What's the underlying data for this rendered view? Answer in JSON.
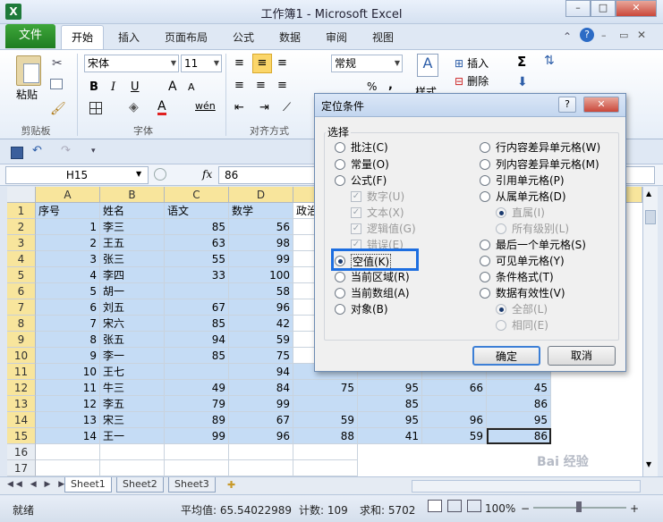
{
  "window": {
    "title": "工作簿1 - Microsoft Excel",
    "app_icon": "X",
    "min": "–",
    "max": "□",
    "close": "✕"
  },
  "ribbon_tabs": {
    "file": "文件",
    "home": "开始",
    "insert": "插入",
    "layout": "页面布局",
    "formula": "公式",
    "data": "数据",
    "review": "审阅",
    "view": "视图"
  },
  "ribbon": {
    "paste_label": "粘贴",
    "clipboard_group": "剪贴板",
    "font_name": "宋体",
    "font_size": "11",
    "font_group": "字体",
    "bold": "B",
    "italic": "I",
    "underline": "U",
    "grow_font": "A",
    "shrink_font": "A",
    "wen": "wén",
    "align_group": "对齐方式",
    "number_format": "常规",
    "percent": "%",
    "comma": ",",
    "styles_label": "样式",
    "insert_label": "插入",
    "delete_label": "删除",
    "sigma": "Σ"
  },
  "formula_bar": {
    "name_box": "H15",
    "fx": "fx",
    "value": "86"
  },
  "grid": {
    "columns": [
      "A",
      "B",
      "C",
      "D",
      "E"
    ],
    "rows": [
      {
        "n": "1",
        "A": "序号",
        "B": "姓名",
        "C": "语文",
        "D": "数学",
        "E": "政治"
      },
      {
        "n": "2",
        "A": "1",
        "B": "李三",
        "C": "85",
        "D": "56"
      },
      {
        "n": "3",
        "A": "2",
        "B": "王五",
        "C": "63",
        "D": "98"
      },
      {
        "n": "4",
        "A": "3",
        "B": "张三",
        "C": "55",
        "D": "99"
      },
      {
        "n": "5",
        "A": "4",
        "B": "李四",
        "C": "33",
        "D": "100"
      },
      {
        "n": "6",
        "A": "5",
        "B": "胡一",
        "C": "",
        "D": "58"
      },
      {
        "n": "7",
        "A": "6",
        "B": "刘五",
        "C": "67",
        "D": "96"
      },
      {
        "n": "8",
        "A": "7",
        "B": "宋六",
        "C": "85",
        "D": "42"
      },
      {
        "n": "9",
        "A": "8",
        "B": "张五",
        "C": "94",
        "D": "59"
      },
      {
        "n": "10",
        "A": "9",
        "B": "李一",
        "C": "85",
        "D": "75"
      },
      {
        "n": "11",
        "A": "10",
        "B": "王七",
        "C": "",
        "D": "94"
      },
      {
        "n": "12",
        "A": "11",
        "B": "牛三",
        "C": "49",
        "D": "84",
        "E": "75",
        "F": "95",
        "G": "66",
        "H": "45"
      },
      {
        "n": "13",
        "A": "12",
        "B": "李五",
        "C": "79",
        "D": "99",
        "E": "",
        "F": "85",
        "G": "",
        "H": "86"
      },
      {
        "n": "14",
        "A": "13",
        "B": "宋三",
        "C": "89",
        "D": "67",
        "E": "59",
        "F": "95",
        "G": "96",
        "H": "95"
      },
      {
        "n": "15",
        "A": "14",
        "B": "王一",
        "C": "99",
        "D": "96",
        "E": "88",
        "F": "41",
        "G": "59",
        "H": "86"
      },
      {
        "n": "16"
      },
      {
        "n": "17"
      }
    ]
  },
  "sheets": {
    "s1": "Sheet1",
    "s2": "Sheet2",
    "s3": "Sheet3"
  },
  "status": {
    "mode": "就绪",
    "average": "平均值: 65.54022989",
    "count": "计数: 109",
    "sum": "求和: 5702",
    "zoom": "100%",
    "minus": "−",
    "plus": "+"
  },
  "dialog": {
    "title": "定位条件",
    "help": "?",
    "close": "✕",
    "group": "选择",
    "left": {
      "comments": "批注(C)",
      "constants": "常量(O)",
      "formulas": "公式(F)",
      "numbers": "数字(U)",
      "text": "文本(X)",
      "logicals": "逻辑值(G)",
      "errors": "错误(E)",
      "blanks": "空值(K)",
      "current_region": "当前区域(R)",
      "current_array": "当前数组(A)",
      "objects": "对象(B)"
    },
    "right": {
      "row_diff": "行内容差异单元格(W)",
      "col_diff": "列内容差异单元格(M)",
      "precedents": "引用单元格(P)",
      "dependents": "从属单元格(D)",
      "direct": "直属(I)",
      "all_levels": "所有级别(L)",
      "last_cell": "最后一个单元格(S)",
      "visible": "可见单元格(Y)",
      "cond_formats": "条件格式(T)",
      "validation": "数据有效性(V)",
      "all": "全部(L)",
      "same": "相同(E)"
    },
    "ok": "确定",
    "cancel": "取消"
  },
  "watermark": "Bai 经验"
}
